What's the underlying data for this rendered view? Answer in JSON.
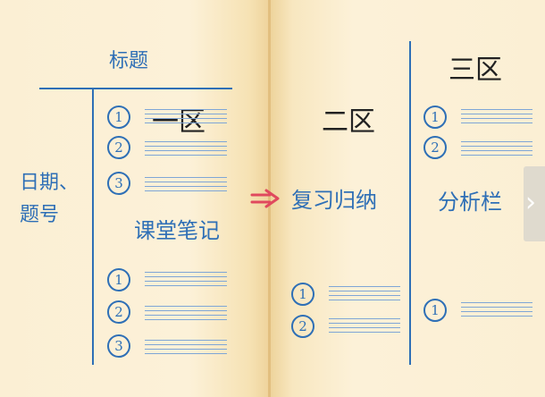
{
  "diagram": {
    "title_label": "标题",
    "date_label_line1": "日期、",
    "date_label_line2": "题号",
    "zone1_label": "一区",
    "zone2_label": "二区",
    "zone3_label": "三区",
    "notes_label": "课堂笔记",
    "review_label": "复习归纳",
    "analysis_label": "分析栏",
    "numbers": [
      "1",
      "2",
      "3"
    ]
  },
  "colors": {
    "ink": "#2e6fb6",
    "arrow": "#e0495e",
    "paper": "#fbefd4"
  },
  "icons": {
    "arrow": "double-arrow-icon",
    "next": "chevron-right-icon"
  }
}
